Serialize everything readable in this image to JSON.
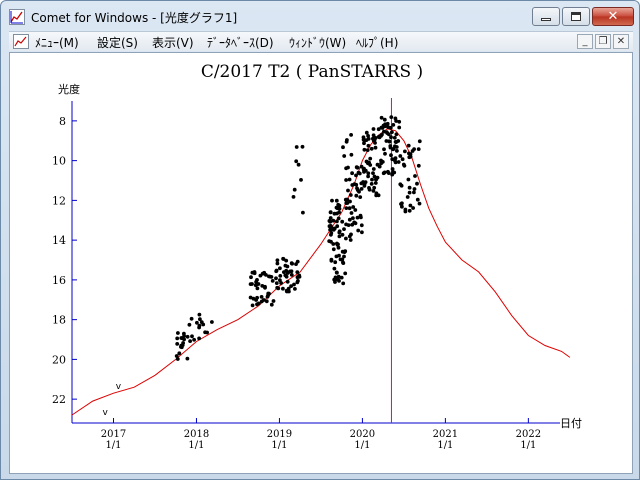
{
  "window": {
    "title": "Comet for Windows - [光度グラフ1]",
    "icon": "chart-app-icon"
  },
  "menubar": {
    "items": [
      {
        "label": "ﾒﾆｭｰ(M)"
      },
      {
        "label": "設定(S)"
      },
      {
        "label": "表示(V)"
      },
      {
        "label": "ﾃﾞｰﾀﾍﾞｰｽ(D)"
      },
      {
        "label": "ｳｨﾝﾄﾞｳ(W)"
      },
      {
        "label": "ﾍﾙﾌﾟ(H)"
      }
    ]
  },
  "chart_data": {
    "type": "scatter",
    "title": "C/2017 T2 ( PanSTARRS )",
    "ylabel": "光度",
    "xlabel": "日付",
    "ylim": [
      23.2,
      7.0
    ],
    "y_ticks": [
      8,
      10,
      12,
      14,
      16,
      18,
      20,
      22
    ],
    "y_inverted": true,
    "x_ticks": [
      {
        "year": "2017",
        "date": "1/1",
        "t": 2017.0
      },
      {
        "year": "2018",
        "date": "1/1",
        "t": 2018.0
      },
      {
        "year": "2019",
        "date": "1/1",
        "t": 2019.0
      },
      {
        "year": "2020",
        "date": "1/1",
        "t": 2020.0
      },
      {
        "year": "2021",
        "date": "1/1",
        "t": 2021.0
      },
      {
        "year": "2022",
        "date": "1/1",
        "t": 2022.0
      }
    ],
    "xlim": [
      2016.5,
      2022.55
    ],
    "marker_v": [
      {
        "label": "v",
        "t": 2017.06,
        "y": 21.5
      },
      {
        "label": "v",
        "t": 2016.9,
        "y": 22.8
      }
    ],
    "perihelion_line_t": 2020.35,
    "colors": {
      "axis": "#0000cc",
      "model_curve": "#dd0000",
      "perihelion_line": "#cc00cc",
      "points": "#000000"
    },
    "model_curve": [
      [
        2016.5,
        22.8
      ],
      [
        2016.75,
        22.1
      ],
      [
        2017.0,
        21.7
      ],
      [
        2017.25,
        21.4
      ],
      [
        2017.5,
        20.8
      ],
      [
        2017.75,
        20.0
      ],
      [
        2018.0,
        19.1
      ],
      [
        2018.25,
        18.5
      ],
      [
        2018.5,
        18.0
      ],
      [
        2018.75,
        17.3
      ],
      [
        2019.0,
        16.3
      ],
      [
        2019.25,
        15.6
      ],
      [
        2019.5,
        14.2
      ],
      [
        2019.75,
        12.6
      ],
      [
        2019.9,
        11.2
      ],
      [
        2020.0,
        10.0
      ],
      [
        2020.1,
        9.2
      ],
      [
        2020.2,
        8.7
      ],
      [
        2020.3,
        8.4
      ],
      [
        2020.4,
        8.5
      ],
      [
        2020.5,
        9.0
      ],
      [
        2020.6,
        9.9
      ],
      [
        2020.7,
        11.2
      ],
      [
        2020.8,
        12.4
      ],
      [
        2020.9,
        13.3
      ],
      [
        2021.0,
        14.1
      ],
      [
        2021.2,
        15.0
      ],
      [
        2021.4,
        15.6
      ],
      [
        2021.6,
        16.6
      ],
      [
        2021.8,
        17.8
      ],
      [
        2022.0,
        18.8
      ],
      [
        2022.2,
        19.3
      ],
      [
        2022.4,
        19.6
      ],
      [
        2022.5,
        19.9
      ]
    ],
    "observation_clusters": [
      {
        "t0": 2017.75,
        "t1": 2017.9,
        "y0": 18.6,
        "y1": 20.0,
        "n": 18
      },
      {
        "t0": 2017.9,
        "t1": 2018.2,
        "y0": 17.6,
        "y1": 19.2,
        "n": 16
      },
      {
        "t0": 2018.65,
        "t1": 2018.95,
        "y0": 15.6,
        "y1": 17.3,
        "n": 40
      },
      {
        "t0": 2018.95,
        "t1": 2019.25,
        "y0": 14.9,
        "y1": 16.6,
        "n": 45
      },
      {
        "t0": 2019.15,
        "t1": 2019.3,
        "y0": 9.2,
        "y1": 12.8,
        "n": 8
      },
      {
        "t0": 2019.6,
        "t1": 2019.8,
        "y0": 12.0,
        "y1": 16.2,
        "n": 70
      },
      {
        "t0": 2019.75,
        "t1": 2019.9,
        "y0": 8.6,
        "y1": 10.2,
        "n": 6
      },
      {
        "t0": 2019.8,
        "t1": 2020.0,
        "y0": 10.3,
        "y1": 14.0,
        "n": 50
      },
      {
        "t0": 2020.0,
        "t1": 2020.2,
        "y0": 8.4,
        "y1": 11.8,
        "n": 55
      },
      {
        "t0": 2020.2,
        "t1": 2020.45,
        "y0": 7.8,
        "y1": 10.8,
        "n": 60
      },
      {
        "t0": 2020.45,
        "t1": 2020.7,
        "y0": 9.0,
        "y1": 12.6,
        "n": 35
      }
    ]
  }
}
